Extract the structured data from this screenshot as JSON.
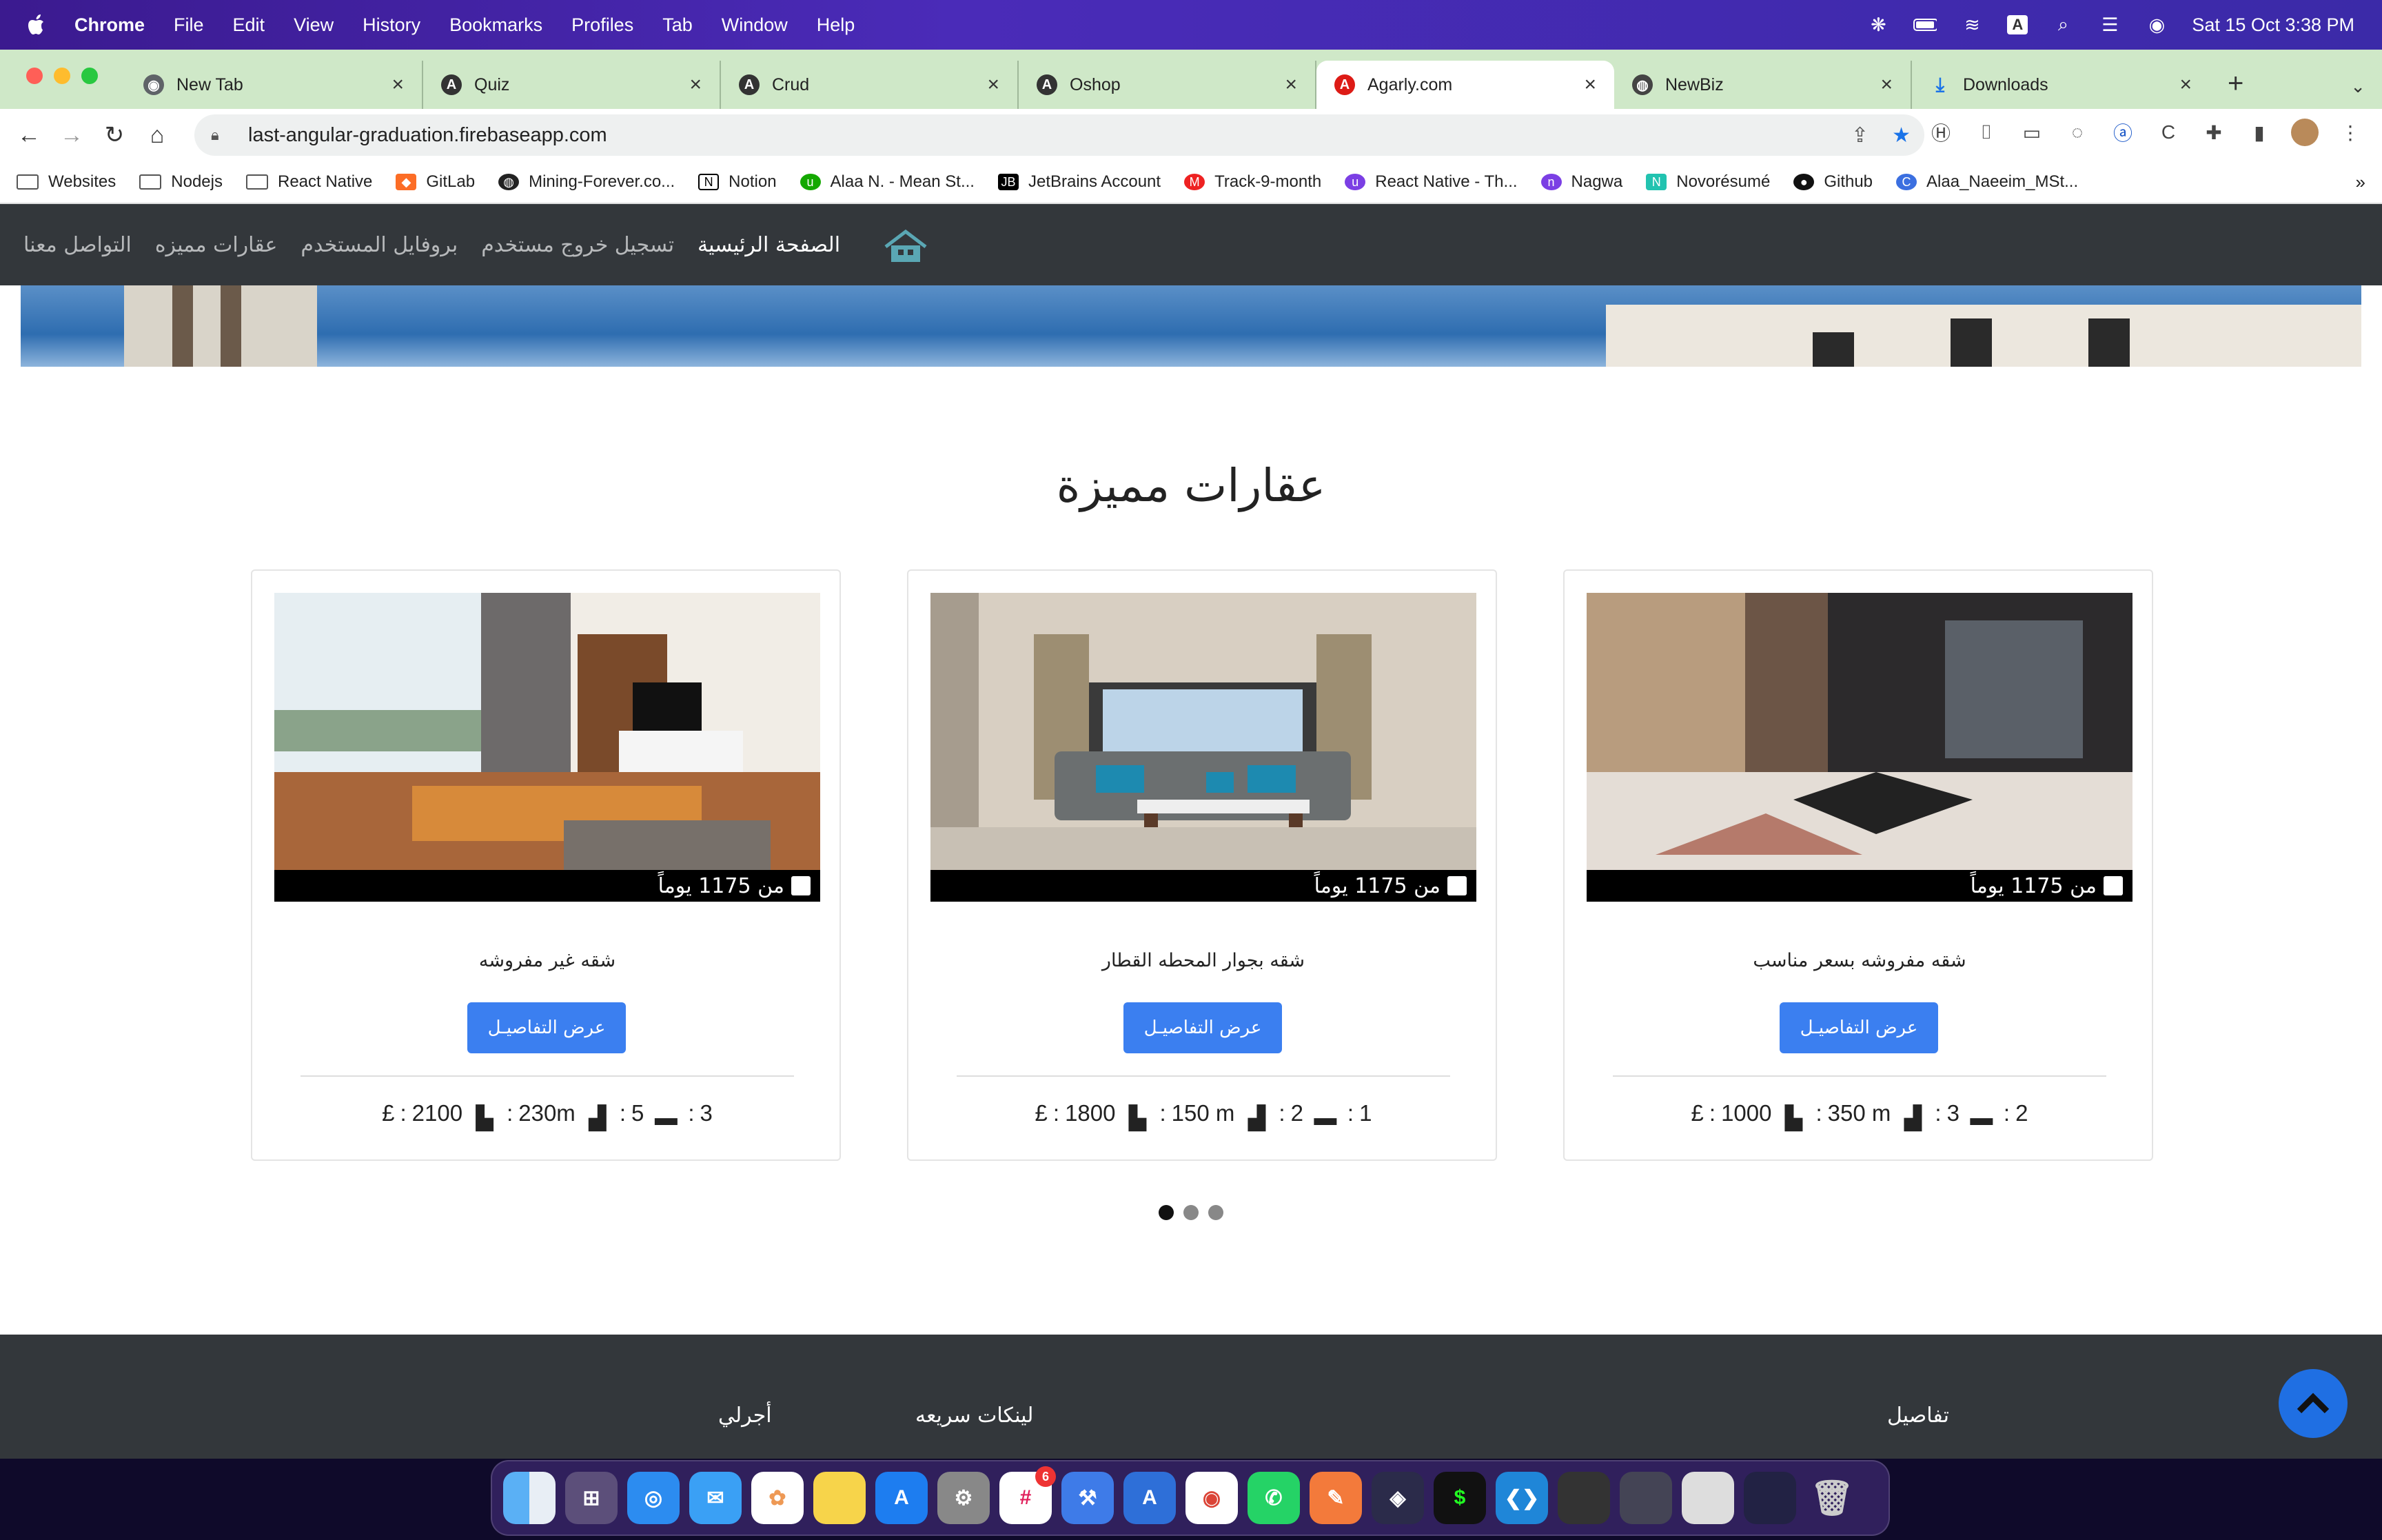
{
  "menubar": {
    "app": "Chrome",
    "items": [
      "File",
      "Edit",
      "View",
      "History",
      "Bookmarks",
      "Profiles",
      "Tab",
      "Window",
      "Help"
    ],
    "datetime": "Sat 15 Oct  3:38 PM"
  },
  "tabs": [
    {
      "title": "New Tab",
      "icon": "chrome-icon",
      "color": "#5f6368"
    },
    {
      "title": "Quiz",
      "icon": "angular-icon",
      "color": "#333"
    },
    {
      "title": "Crud",
      "icon": "angular-icon",
      "color": "#333"
    },
    {
      "title": "Oshop",
      "icon": "angular-icon",
      "color": "#333"
    },
    {
      "title": "Agarly.com",
      "icon": "angular-red-icon",
      "color": "#dd1b16"
    },
    {
      "title": "NewBiz",
      "icon": "globe-icon",
      "color": "#444"
    },
    {
      "title": "Downloads",
      "icon": "download-icon",
      "color": "#1a73e8"
    }
  ],
  "url": "last-angular-graduation.firebaseapp.com",
  "bookmarks": [
    "Websites",
    "Nodejs",
    "React Native",
    "GitLab",
    "Mining-Forever.co...",
    "Notion",
    "Alaa N. - Mean St...",
    "JetBrains Account",
    "Track-9-month",
    "React Native - Th...",
    "Nagwa",
    "Novorésumé",
    "Github",
    "Alaa_Naeeim_MSt..."
  ],
  "site": {
    "nav": [
      "الصفحة الرئيسية",
      "تسجيل خروج مستخدم",
      "بروفايل المستخدم",
      "عقارات مميزه",
      "التواصل معنا"
    ],
    "section_title": "عقارات مميزة",
    "cards": [
      {
        "title": "شقه مفروشه بسعر مناسب",
        "duration": "من 1175 يوماً",
        "button": "عرض التفاصيـل",
        "beds": "2",
        "baths": "3",
        "area": "350 m",
        "price": "1000"
      },
      {
        "title": "شقه بجوار المحطه القطار",
        "duration": "من 1175 يوماً",
        "button": "عرض التفاصيـل",
        "beds": "1",
        "baths": "2",
        "area": "150 m",
        "price": "1800"
      },
      {
        "title": "شقه غير مفروشه",
        "duration": "من 1175 يوماً",
        "button": "عرض التفاصيـل",
        "beds": "3",
        "baths": "5",
        "area": "230m",
        "price": "2100"
      }
    ],
    "carousel_dots": 3,
    "footer": {
      "col1": "تفاصيل",
      "col2": "لينكات سريعه",
      "col3": "أجرلي"
    }
  },
  "colors": {
    "accent": "#3b7ff0",
    "nav": "#33373b"
  }
}
